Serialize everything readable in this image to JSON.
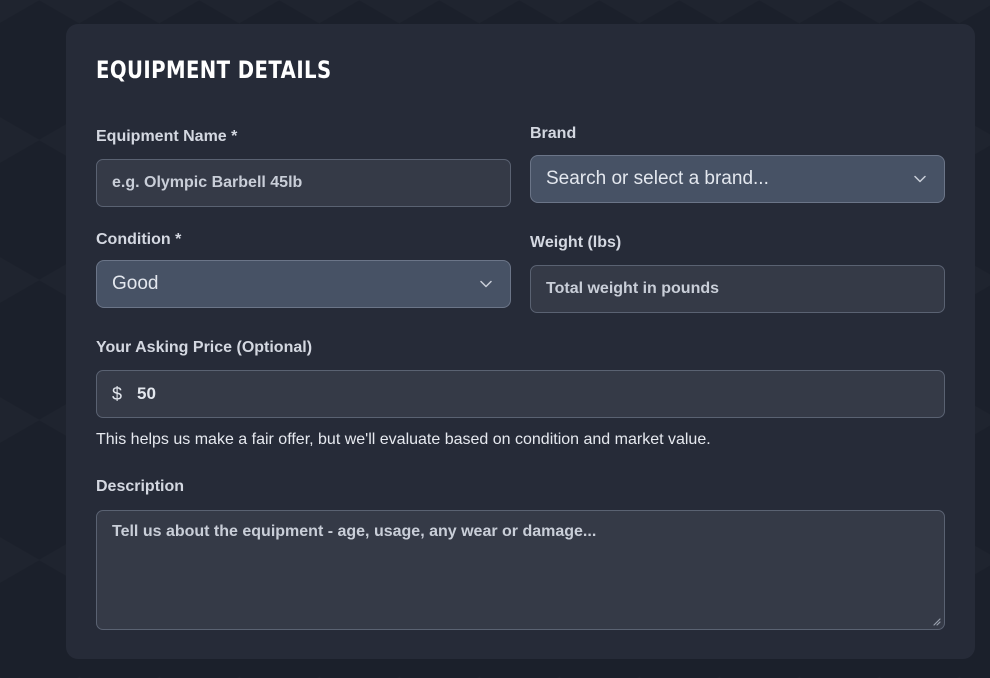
{
  "form": {
    "title": "Equipment Details",
    "equipment_name": {
      "label": "Equipment Name *",
      "placeholder": "e.g. Olympic Barbell 45lb",
      "value": ""
    },
    "brand": {
      "label": "Brand",
      "selected": "Search or select a brand...",
      "icon": "chevron-down-icon"
    },
    "condition": {
      "label": "Condition *",
      "selected": "Good",
      "icon": "chevron-down-icon"
    },
    "weight": {
      "label": "Weight (lbs)",
      "placeholder": "Total weight in pounds",
      "value": ""
    },
    "asking_price": {
      "label": "Your Asking Price (Optional)",
      "currency_symbol": "$",
      "value": "50",
      "help_text": "This helps us make a fair offer, but we'll evaluate based on condition and market value."
    },
    "description": {
      "label": "Description",
      "placeholder": "Tell us about the equipment - age, usage, any wear or damage...",
      "value": ""
    }
  },
  "colors": {
    "background": "#1b202b",
    "card": "#262b38",
    "input": "#353a47",
    "select": "#475265",
    "text": "#ffffff"
  }
}
